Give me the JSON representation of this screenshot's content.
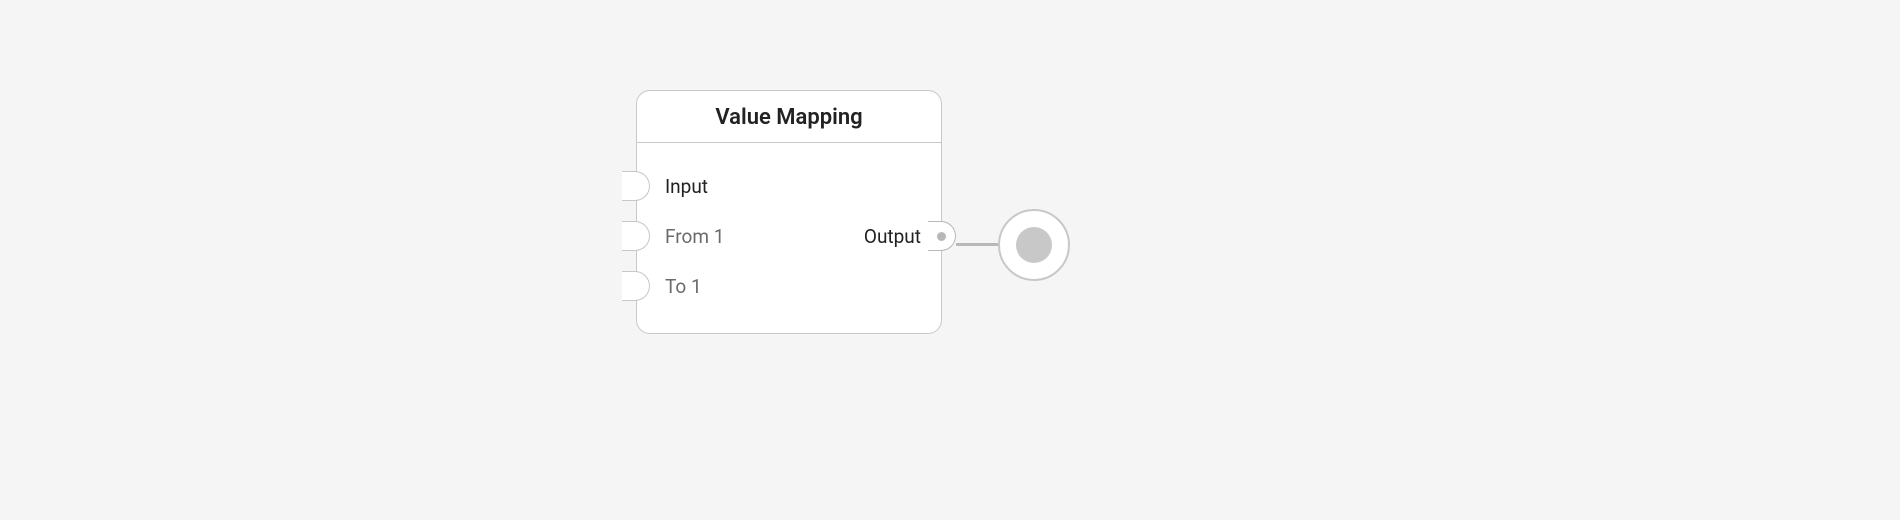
{
  "node": {
    "title": "Value Mapping",
    "inputs": [
      {
        "label": "Input"
      },
      {
        "label": "From 1"
      },
      {
        "label": "To 1"
      }
    ],
    "outputs": [
      {
        "label": "Output"
      }
    ]
  }
}
